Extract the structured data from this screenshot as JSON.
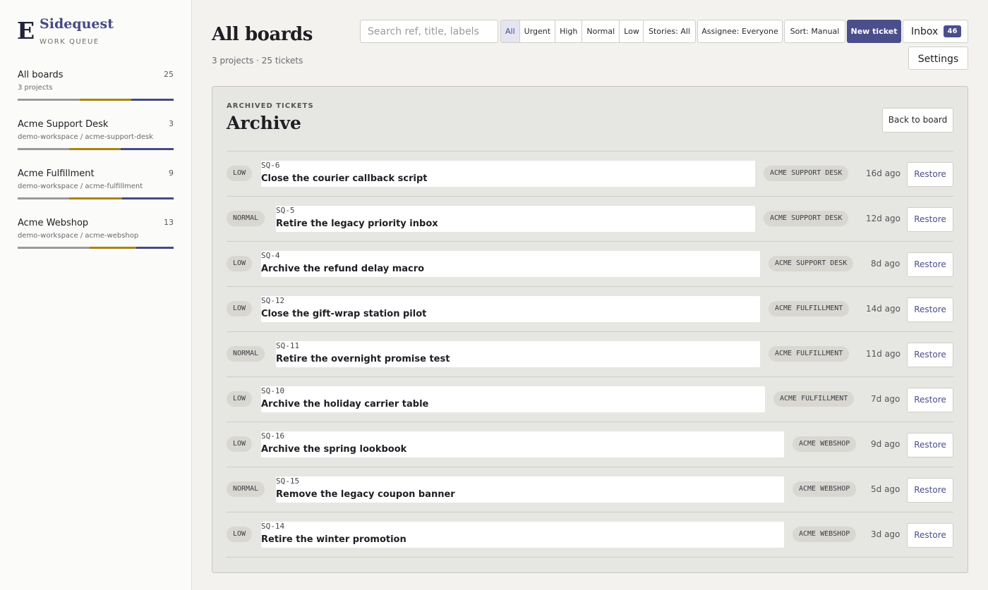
{
  "brand": {
    "mark": "E",
    "name": "Sidequest",
    "subtitle": "WORK QUEUE"
  },
  "colors": {
    "accent": "#4a4f8c",
    "progress_gray": "#9a9a9e",
    "progress_gold": "#a8840f",
    "progress_navy": "#454b85"
  },
  "sidebar": {
    "projects": [
      {
        "name": "All boards",
        "count": "25",
        "meta": "3 projects",
        "progress": [
          0.4,
          0.33,
          0.27
        ]
      },
      {
        "name": "Acme Support Desk",
        "count": "3",
        "meta": "demo-workspace / acme-support-desk",
        "progress": [
          0.33,
          0.33,
          0.34
        ]
      },
      {
        "name": "Acme Fulfillment",
        "count": "9",
        "meta": "demo-workspace / acme-fulfillment",
        "progress": [
          0.33,
          0.34,
          0.33
        ]
      },
      {
        "name": "Acme Webshop",
        "count": "13",
        "meta": "demo-workspace / acme-webshop",
        "progress": [
          0.46,
          0.3,
          0.24
        ]
      }
    ]
  },
  "header": {
    "title": "All boards",
    "meta": "3 projects · 25 tickets",
    "search_placeholder": "Search ref, title, labels",
    "priority_filters": [
      "All",
      "Urgent",
      "High",
      "Normal",
      "Low"
    ],
    "priority_selected": "All",
    "stories_filter": "Stories: All",
    "assignee_filter": "Assignee: Everyone",
    "sort": "Sort: Manual",
    "new_ticket": "New ticket",
    "inbox_label": "Inbox",
    "inbox_count": "46",
    "settings": "Settings"
  },
  "archive": {
    "eyebrow": "ARCHIVED TICKETS",
    "title": "Archive",
    "back_label": "Back to board",
    "restore_label": "Restore",
    "rows": [
      {
        "priority": "LOW",
        "ref": "SQ-6",
        "title": "Close the courier callback script",
        "project": "ACME SUPPORT DESK",
        "age": "16d ago"
      },
      {
        "priority": "NORMAL",
        "ref": "SQ-5",
        "title": "Retire the legacy priority inbox",
        "project": "ACME SUPPORT DESK",
        "age": "12d ago"
      },
      {
        "priority": "LOW",
        "ref": "SQ-4",
        "title": "Archive the refund delay macro",
        "project": "ACME SUPPORT DESK",
        "age": "8d ago"
      },
      {
        "priority": "LOW",
        "ref": "SQ-12",
        "title": "Close the gift-wrap station pilot",
        "project": "ACME FULFILLMENT",
        "age": "14d ago"
      },
      {
        "priority": "NORMAL",
        "ref": "SQ-11",
        "title": "Retire the overnight promise test",
        "project": "ACME FULFILLMENT",
        "age": "11d ago"
      },
      {
        "priority": "LOW",
        "ref": "SQ-10",
        "title": "Archive the holiday carrier table",
        "project": "ACME FULFILLMENT",
        "age": "7d ago"
      },
      {
        "priority": "LOW",
        "ref": "SQ-16",
        "title": "Archive the spring lookbook",
        "project": "ACME WEBSHOP",
        "age": "9d ago"
      },
      {
        "priority": "NORMAL",
        "ref": "SQ-15",
        "title": "Remove the legacy coupon banner",
        "project": "ACME WEBSHOP",
        "age": "5d ago"
      },
      {
        "priority": "LOW",
        "ref": "SQ-14",
        "title": "Retire the winter promotion",
        "project": "ACME WEBSHOP",
        "age": "3d ago"
      }
    ]
  }
}
